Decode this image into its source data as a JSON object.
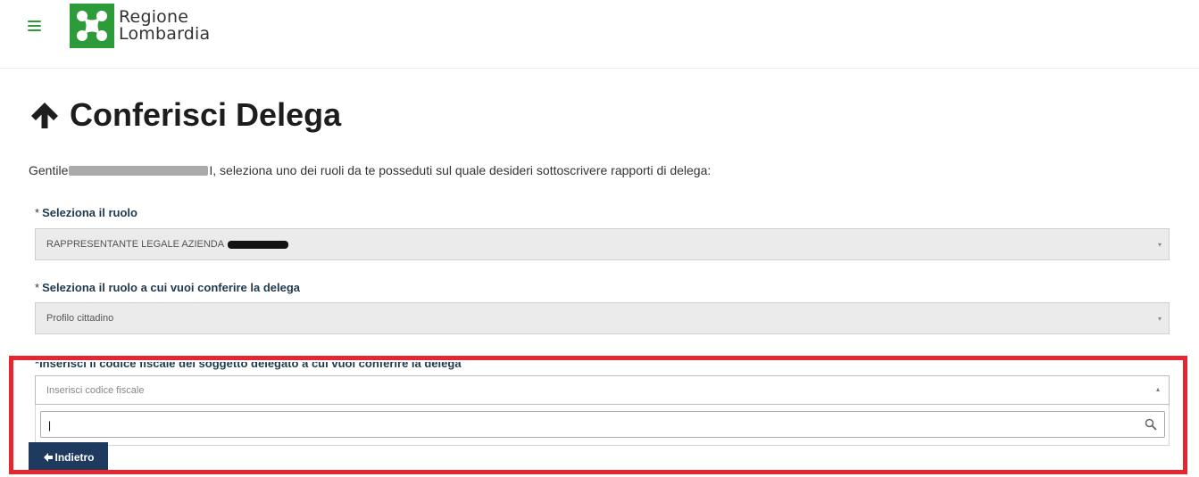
{
  "header": {
    "menu_icon": "hamburger-icon",
    "logo_line1": "Regione",
    "logo_line2": "Lombardia",
    "brand_color": "#2e9b3a"
  },
  "page": {
    "title": "Conferisci Delega",
    "title_icon": "arrow-up-icon",
    "intro_prefix": "Gentile",
    "intro_suffix": "I, seleziona uno dei ruoli da te posseduti sul quale desideri sottoscrivere rapporti di delega:"
  },
  "form": {
    "required_mark": "*",
    "role_label": "Seleziona il ruolo",
    "role_value": "RAPPRESENTANTE LEGALE AZIENDA",
    "delegate_role_label": "Seleziona il ruolo a cui vuoi conferire la delega",
    "delegate_role_value": "Profilo cittadino",
    "fiscal_label": "Inserisci il codice fiscale del soggetto delegato a cui vuoi conferire la delega",
    "fiscal_placeholder": "Inserisci codice fiscale",
    "search_value": "|",
    "select_caret": "▾",
    "select_caret_open": "▴"
  },
  "actions": {
    "back_label": "Indietro",
    "back_icon": "arrow-left-icon"
  },
  "colors": {
    "highlight": "#e3262f",
    "button_bg": "#1e3a5f"
  }
}
